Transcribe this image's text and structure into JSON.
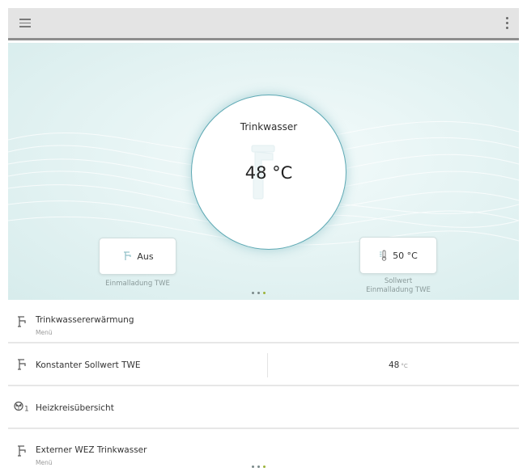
{
  "toolbar": {
    "menu_icon": "hamburger-menu-icon",
    "more_icon": "more-vertical-icon"
  },
  "hero": {
    "title": "Trinkwasser",
    "value": "48 °C",
    "left_card": {
      "icon": "faucet-icon",
      "label": "Aus",
      "caption": "Einmalladung TWE"
    },
    "right_card": {
      "icon": "thermometer-icon",
      "label": "50 °C",
      "caption_line1": "Sollwert",
      "caption_line2": "Einmalladung TWE"
    },
    "page_dots": 3,
    "active_dot": 3
  },
  "list": {
    "rows": [
      {
        "icon": "faucet-icon",
        "label": "Trinkwassererwärmung",
        "sub": "Menü"
      },
      {
        "icon": "faucet-icon",
        "label": "Konstanter Sollwert TWE",
        "value": "48",
        "unit": "°C"
      },
      {
        "icon": "pump-circuit-icon",
        "label": "Heizkreisübersicht",
        "index": "1"
      },
      {
        "icon": "faucet-icon",
        "label": "Externer WEZ Trinkwasser",
        "sub": "Menü"
      }
    ]
  },
  "colors": {
    "accent": "#5ea9b4",
    "active_dot": "#9cb33a",
    "topbar": "#e4e4e4"
  }
}
